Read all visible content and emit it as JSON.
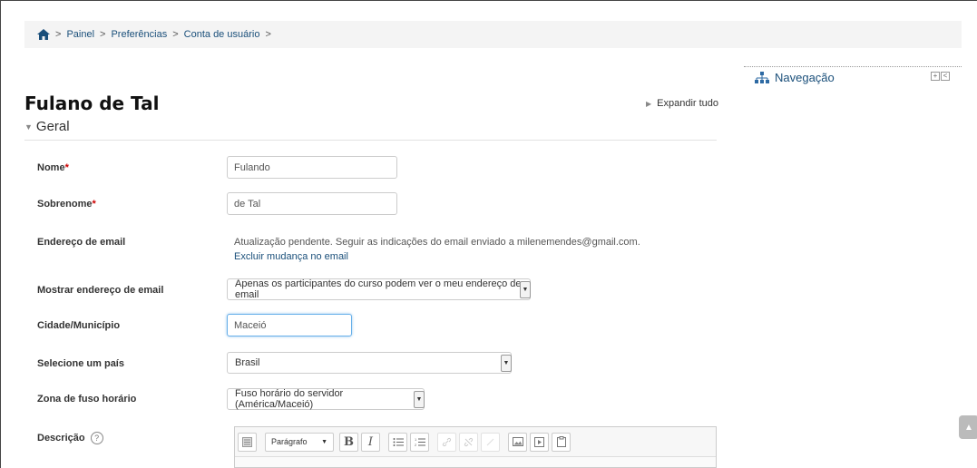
{
  "breadcrumb": {
    "items": [
      "Painel",
      "Preferências",
      "Conta de usuário"
    ],
    "separator": ">"
  },
  "page_title": "Fulano de Tal",
  "expand_all": "Expandir tudo",
  "section": "Geral",
  "form": {
    "first_name": {
      "label": "Nome",
      "required_mark": "*",
      "value": "Fulando"
    },
    "last_name": {
      "label": "Sobrenome",
      "required_mark": "*",
      "value": "de Tal"
    },
    "email": {
      "label": "Endereço de email",
      "pending_text": "Atualização pendente. Seguir as indicações do email enviado a milenemendes@gmail.com.",
      "cancel_link": "Excluir mudança no email"
    },
    "show_email": {
      "label": "Mostrar endereço de email",
      "value": "Apenas os participantes do curso podem ver o meu endereço de email"
    },
    "city": {
      "label": "Cidade/Município",
      "value": "Maceió"
    },
    "country": {
      "label": "Selecione um país",
      "value": "Brasil"
    },
    "timezone": {
      "label": "Zona de fuso horário",
      "value": "Fuso horário do servidor (América/Maceió)"
    },
    "description": {
      "label": "Descrição",
      "help": "?",
      "paragraph_select": "Parágrafo",
      "toolbar_icons": [
        "toggle-toolbar-icon",
        "bold-icon",
        "italic-icon",
        "bullet-list-icon",
        "numbered-list-icon",
        "link-icon",
        "unlink-icon",
        "insert-emoticon-icon",
        "insert-image-icon",
        "insert-media-icon",
        "manage-files-icon"
      ]
    }
  },
  "navigation": {
    "title": "Navegação",
    "controls": [
      "+",
      "<"
    ]
  },
  "colors": {
    "link": "#1a4f7a",
    "required": "#cc0000",
    "focus_border": "#66afe9"
  }
}
